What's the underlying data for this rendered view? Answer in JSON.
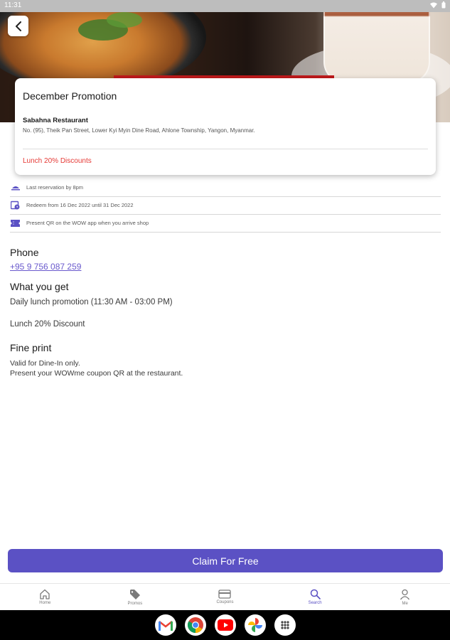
{
  "status_bar": {
    "time": "11:31"
  },
  "promo": {
    "title": "December Promotion",
    "restaurant": "Sabahna Restaurant",
    "address": "No. (95), Theik Pan Street, Lower Kyi Myin Dine Road, Ahlone Township, Yangon, Myanmar.",
    "discount": "Lunch 20% Discounts"
  },
  "info": {
    "reservation": "Last reservation by 8pm",
    "redeem": "Redeem from 16 Dec 2022 until 31 Dec 2022",
    "present_qr": "Present QR on the WOW app when you arrive shop"
  },
  "phone": {
    "heading": "Phone",
    "number": "+95 9 756 087 259"
  },
  "what_you_get": {
    "heading": "What you get",
    "line1": "Daily lunch promotion (11:30 AM - 03:00 PM)",
    "line2": "Lunch 20% Discount"
  },
  "fine_print": {
    "heading": "Fine print",
    "line1": "Valid for Dine-In only.",
    "line2": "Present your WOWme coupon QR at the restaurant."
  },
  "claim_button": "Claim For Free",
  "nav": {
    "active": "search",
    "accent_color": "#5b51c4",
    "items": [
      {
        "label": "Home",
        "icon": "home-icon"
      },
      {
        "label": "Promos",
        "icon": "tag-icon"
      },
      {
        "label": "Coupons",
        "icon": "card-icon"
      },
      {
        "label": "Search",
        "icon": "search-icon"
      },
      {
        "label": "Me",
        "icon": "person-icon"
      }
    ]
  },
  "dock_apps": [
    "gmail-icon",
    "chrome-icon",
    "youtube-icon",
    "photos-icon",
    "app-drawer-icon"
  ]
}
